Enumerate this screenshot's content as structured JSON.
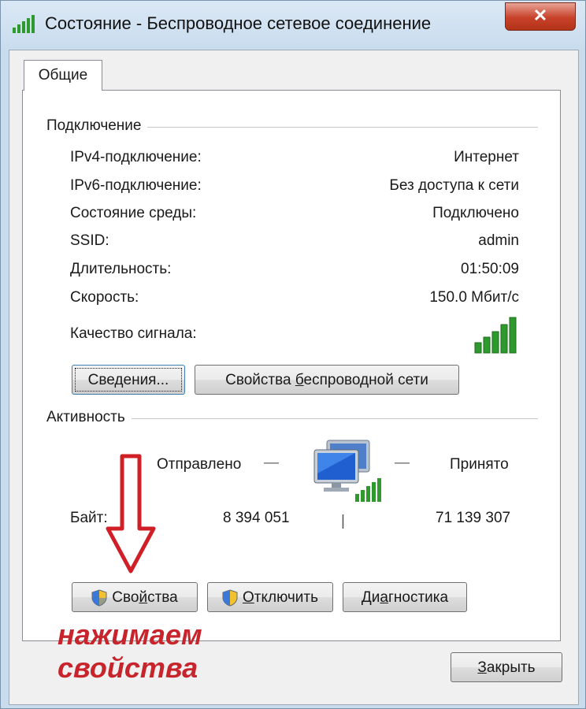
{
  "window": {
    "title": "Состояние - Беспроводное сетевое соединение",
    "close_glyph": "✕"
  },
  "tabs": [
    {
      "label": "Общие",
      "selected": true
    }
  ],
  "connection": {
    "group_label": "Подключение",
    "rows": [
      {
        "label": "IPv4-подключение:",
        "value": "Интернет"
      },
      {
        "label": "IPv6-подключение:",
        "value": "Без доступа к сети"
      },
      {
        "label": "Состояние среды:",
        "value": "Подключено"
      },
      {
        "label": "SSID:",
        "value": "admin"
      },
      {
        "label": "Длительность:",
        "value": "01:50:09"
      },
      {
        "label": "Скорость:",
        "value": "150.0 Мбит/с"
      }
    ],
    "signal_label": "Качество сигнала:",
    "signal_bars_lit": 5,
    "signal_bars_total": 5,
    "details_button": "Сведения...",
    "wireless_props_button_pre": "Свойства ",
    "wireless_props_button_u": "б",
    "wireless_props_button_post": "еспроводной сети"
  },
  "activity": {
    "group_label": "Активность",
    "sent_label": "Отправлено",
    "received_label": "Принято",
    "bytes_label": "Байт:",
    "sent_value": "8 394 051",
    "received_value": "71 139 307",
    "dash": "—",
    "separator": "|"
  },
  "buttons": {
    "properties_pre": "Сво",
    "properties_u": "й",
    "properties_post": "ства",
    "disconnect_u": "О",
    "disconnect_post": "тключить",
    "diagnostics_pre": "Ди",
    "diagnostics_u": "а",
    "diagnostics_post": "гностика",
    "close_u": "З",
    "close_post": "акрыть"
  },
  "annotation": {
    "line1": "нажимаем",
    "line2": "свойства",
    "color": "#c8242c"
  },
  "colors": {
    "signal_green": "#2e9a2e",
    "title_bar": "#c9dcee"
  }
}
